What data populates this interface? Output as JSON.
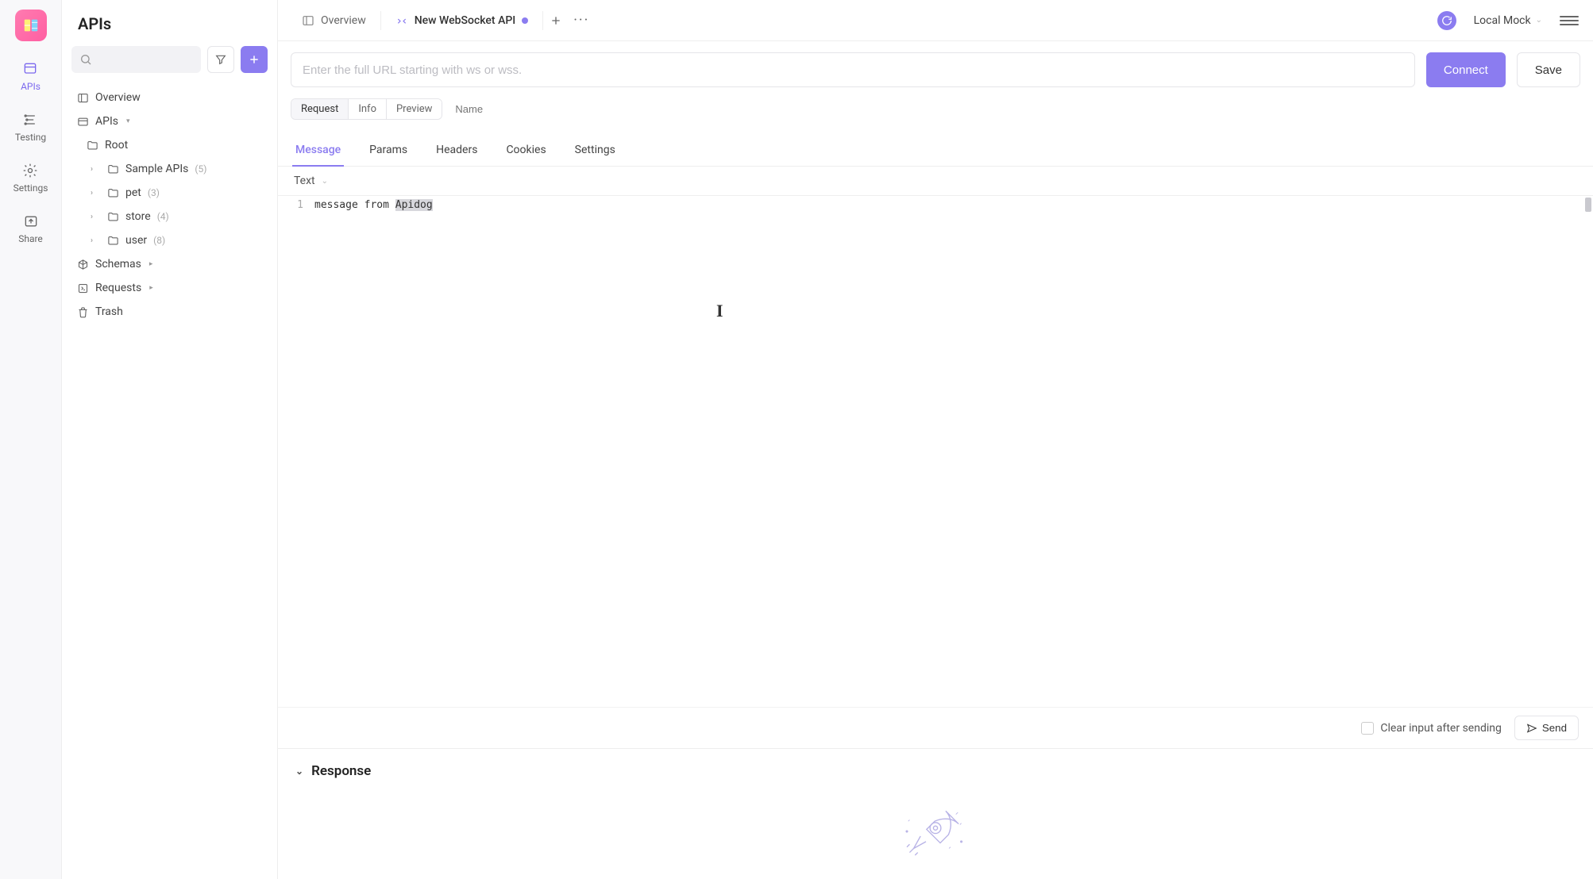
{
  "rail": {
    "items": [
      {
        "label": "APIs"
      },
      {
        "label": "Testing"
      },
      {
        "label": "Settings"
      },
      {
        "label": "Share"
      }
    ]
  },
  "sidebar": {
    "title": "APIs",
    "search_placeholder": "",
    "tree": {
      "overview": "Overview",
      "apis_label": "APIs",
      "root_label": "Root",
      "folders": [
        {
          "label": "Sample APIs",
          "count": "(5)"
        },
        {
          "label": "pet",
          "count": "(3)"
        },
        {
          "label": "store",
          "count": "(4)"
        },
        {
          "label": "user",
          "count": "(8)"
        }
      ],
      "schemas": "Schemas",
      "requests": "Requests",
      "trash": "Trash"
    }
  },
  "tabs": {
    "overview": "Overview",
    "active": "New WebSocket API",
    "env_label": "Local Mock"
  },
  "urlbar": {
    "placeholder": "Enter the full URL starting with ws or wss.",
    "connect": "Connect",
    "save": "Save"
  },
  "seg": {
    "request": "Request",
    "info": "Info",
    "preview": "Preview",
    "name_placeholder": "Name"
  },
  "subtabs": {
    "message": "Message",
    "params": "Params",
    "headers": "Headers",
    "cookies": "Cookies",
    "settings": "Settings"
  },
  "format": {
    "label": "Text"
  },
  "editor": {
    "line_no": "1",
    "prefix": "message from ",
    "highlight": "Apidog"
  },
  "footer": {
    "clear": "Clear input after sending",
    "send": "Send"
  },
  "response": {
    "title": "Response"
  }
}
